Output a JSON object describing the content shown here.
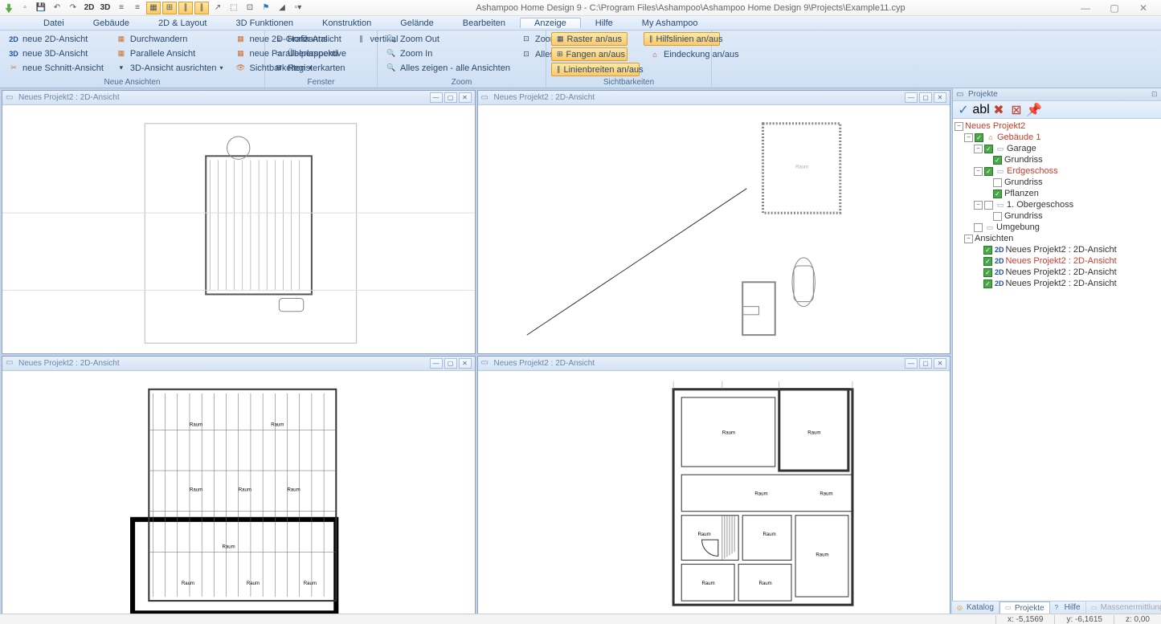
{
  "title": "Ashampoo Home Design 9 - C:\\Program Files\\Ashampoo\\Ashampoo Home Design 9\\Projects\\Example11.cyp",
  "menu": [
    "Datei",
    "Gebäude",
    "2D & Layout",
    "3D Funktionen",
    "Konstruktion",
    "Gelände",
    "Bearbeiten",
    "Anzeige",
    "Hilfe",
    "My Ashampoo"
  ],
  "ribbon": {
    "group1": {
      "title": "Neue Ansichten",
      "items": [
        {
          "icon": "2D",
          "label": "neue 2D-Ansicht"
        },
        {
          "icon": "3D",
          "label": "neue 3D-Ansicht"
        },
        {
          "icon": "✂",
          "label": "neue Schnitt-Ansicht"
        }
      ],
      "col2": [
        {
          "icon": "▦",
          "label": "Durchwandern"
        },
        {
          "icon": "▦",
          "label": "Parallele Ansicht"
        },
        {
          "icon": "▾",
          "label": "3D-Ansicht ausrichten"
        }
      ],
      "col3": [
        {
          "icon": "▦",
          "label": "neue 2D-Grafik-Ansicht"
        },
        {
          "icon": "▦",
          "label": "neue Parallelperspektive"
        },
        {
          "icon": "👁",
          "label": "Sichtbarkeiten"
        }
      ]
    },
    "group2": {
      "title": "Fenster",
      "items": [
        {
          "icon": "≡",
          "label": "Horizontal"
        },
        {
          "icon": "▭",
          "label": "Überlappend"
        },
        {
          "icon": "⊞",
          "label": "Registerkarten"
        }
      ],
      "col2": [
        {
          "icon": "∥",
          "label": "vertikal"
        }
      ]
    },
    "group3": {
      "title": "Zoom",
      "items": [
        {
          "icon": "🔍",
          "label": "Zoom Out"
        },
        {
          "icon": "🔍",
          "label": "Zoom In"
        },
        {
          "icon": "🔍",
          "label": "Alles zeigen - alle Ansichten"
        }
      ],
      "col2": [
        {
          "icon": "⊡",
          "label": "Zoom Rechteck"
        },
        {
          "icon": "",
          "label": ""
        },
        {
          "icon": "⊡",
          "label": "Alles zeigen"
        }
      ]
    },
    "group4": {
      "title": "Sichtbarkeiten",
      "toggles": [
        {
          "label": "Raster an/aus",
          "on": true
        },
        {
          "label": "Fangen an/aus",
          "on": true
        },
        {
          "label": "Linienbreiten an/aus",
          "on": true
        }
      ],
      "col2": [
        {
          "label": "Hilfslinien an/aus",
          "on": true
        },
        {
          "label": "Eindeckung an/aus",
          "on": false
        }
      ]
    }
  },
  "viewports": [
    {
      "title": "Neues Projekt2 : 2D-Ansicht"
    },
    {
      "title": "Neues Projekt2 : 2D-Ansicht"
    },
    {
      "title": "Neues Projekt2 : 2D-Ansicht"
    },
    {
      "title": "Neues Projekt2 : 2D-Ansicht"
    }
  ],
  "projects_panel": {
    "title": "Projekte",
    "tree": {
      "root": "Neues Projekt2",
      "building": "Gebäude 1",
      "garage": "Garage",
      "garage_grundriss": "Grundriss",
      "erdgeschoss": "Erdgeschoss",
      "erd_grundriss": "Grundriss",
      "erd_pflanzen": "Pflanzen",
      "og": "1. Obergeschoss",
      "og_grundriss": "Grundriss",
      "umgebung": "Umgebung",
      "ansichten": "Ansichten",
      "views": [
        "Neues Projekt2 : 2D-Ansicht",
        "Neues Projekt2 : 2D-Ansicht",
        "Neues Projekt2 : 2D-Ansicht",
        "Neues Projekt2 : 2D-Ansicht"
      ]
    }
  },
  "bottom_tabs": [
    "Katalog",
    "Projekte",
    "Hilfe",
    "Massenermittlung"
  ],
  "status": {
    "x": "x: -5,1569",
    "y": "y: -6,1615",
    "z": "z: 0,00"
  }
}
